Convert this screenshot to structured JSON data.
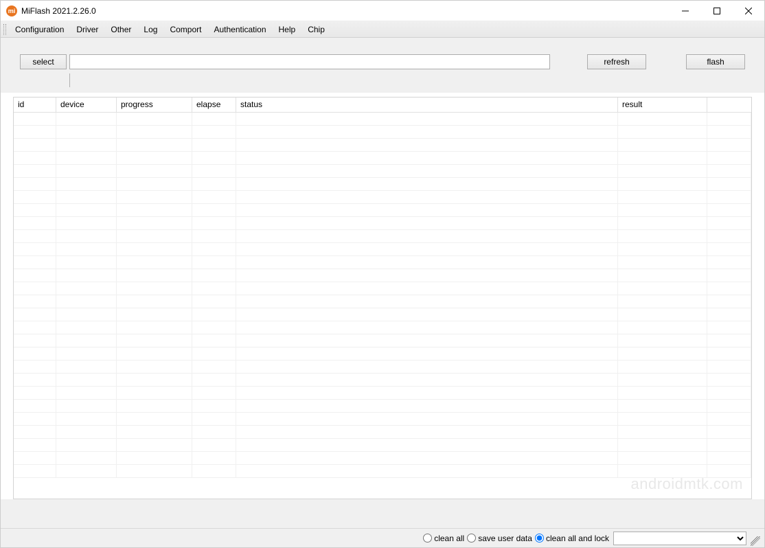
{
  "window": {
    "title": "MiFlash 2021.2.26.0",
    "icon_label": "mi"
  },
  "menu": {
    "items": [
      "Configuration",
      "Driver",
      "Other",
      "Log",
      "Comport",
      "Authentication",
      "Help",
      "Chip"
    ]
  },
  "toolbar": {
    "select_label": "select",
    "path_value": "",
    "refresh_label": "refresh",
    "flash_label": "flash"
  },
  "table": {
    "columns": {
      "id": "id",
      "device": "device",
      "progress": "progress",
      "elapse": "elapse",
      "status": "status",
      "result": "result"
    },
    "row_count": 28
  },
  "footer": {
    "radios": {
      "clean_all": "clean all",
      "save_user_data": "save user data",
      "clean_all_and_lock": "clean all and lock",
      "selected": "clean_all_and_lock"
    },
    "combo_value": ""
  },
  "watermark": "androidmtk.com"
}
